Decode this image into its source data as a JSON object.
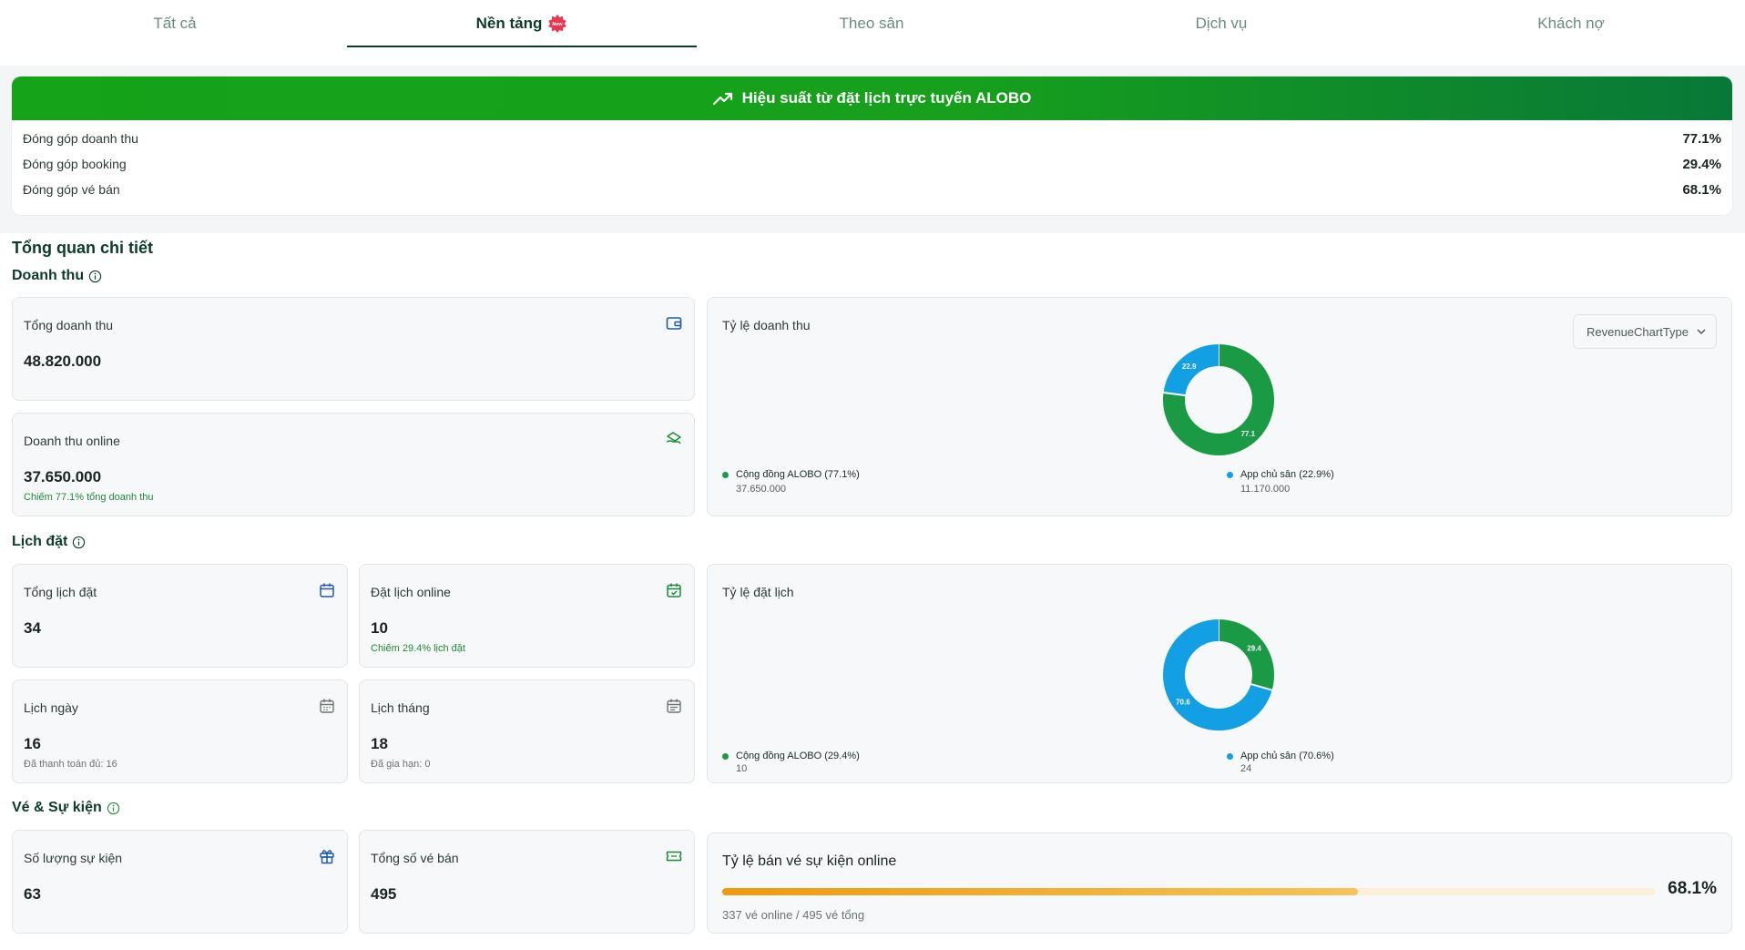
{
  "tabs": [
    {
      "label": "Tất cả"
    },
    {
      "label": "Nền tảng",
      "badge": "New"
    },
    {
      "label": "Theo sân"
    },
    {
      "label": "Dịch vụ"
    },
    {
      "label": "Khách nợ"
    }
  ],
  "performance": {
    "title": "Hiệu suất từ đặt lịch trực tuyến ALOBO",
    "rows": [
      {
        "label": "Đóng góp doanh thu",
        "value": "77.1%"
      },
      {
        "label": "Đóng góp booking",
        "value": "29.4%"
      },
      {
        "label": "Đóng góp vé bán",
        "value": "68.1%"
      }
    ]
  },
  "overview": {
    "title": "Tổng quan chi tiết",
    "revenue": {
      "section_label": "Doanh thu",
      "total": {
        "label": "Tổng doanh thu",
        "value": "48.820.000"
      },
      "online": {
        "label": "Doanh thu online",
        "value": "37.650.000",
        "note": "Chiếm 77.1% tổng doanh thu"
      },
      "chart": {
        "title": "Tỷ lệ doanh thu",
        "select_value": "RevenueChartType",
        "legend": [
          {
            "label": "Cộng đồng ALOBO (77.1%)",
            "sub": "37.650.000"
          },
          {
            "label": "App chủ sân (22.9%)",
            "sub": "11.170.000"
          }
        ],
        "slice_labels": [
          "77.1",
          "22.9"
        ]
      }
    },
    "booking": {
      "section_label": "Lịch đặt",
      "total": {
        "label": "Tổng lịch đặt",
        "value": "34"
      },
      "online": {
        "label": "Đặt lịch online",
        "value": "10",
        "note": "Chiếm 29.4% lịch đặt"
      },
      "daily": {
        "label": "Lịch ngày",
        "value": "16",
        "note": "Đã thanh toán đủ: 16"
      },
      "monthly": {
        "label": "Lịch tháng",
        "value": "18",
        "note": "Đã gia hạn: 0"
      },
      "chart": {
        "title": "Tỷ lệ đặt lịch",
        "legend": [
          {
            "label": "Cộng đồng ALOBO (29.4%)",
            "sub": "10"
          },
          {
            "label": "App chủ sân (70.6%)",
            "sub": "24"
          }
        ],
        "slice_labels": [
          "29.4",
          "70.6"
        ]
      }
    },
    "tickets": {
      "section_label": "Vé & Sự kiện",
      "events": {
        "label": "Số lượng sự kiện",
        "value": "63"
      },
      "sold": {
        "label": "Tổng số vé bán",
        "value": "495"
      },
      "online_rate": {
        "title": "Tỷ lệ bán vé sự kiện online",
        "value": "68.1%",
        "note": "337 vé online / 495 vé tổng",
        "fraction": 0.681
      }
    }
  },
  "colors": {
    "alobo_green": "#1a9a44",
    "owner_blue": "#129fe3",
    "brand_dark": "#0c3b2c"
  },
  "chart_data": [
    {
      "type": "pie",
      "title": "Tỷ lệ doanh thu",
      "categories": [
        "Cộng đồng ALOBO",
        "App chủ sân"
      ],
      "values": [
        77.1,
        22.9
      ],
      "legend": "bottom"
    },
    {
      "type": "pie",
      "title": "Tỷ lệ đặt lịch",
      "categories": [
        "Cộng đồng ALOBO",
        "App chủ sân"
      ],
      "values": [
        29.4,
        70.6
      ],
      "legend": "bottom"
    }
  ]
}
